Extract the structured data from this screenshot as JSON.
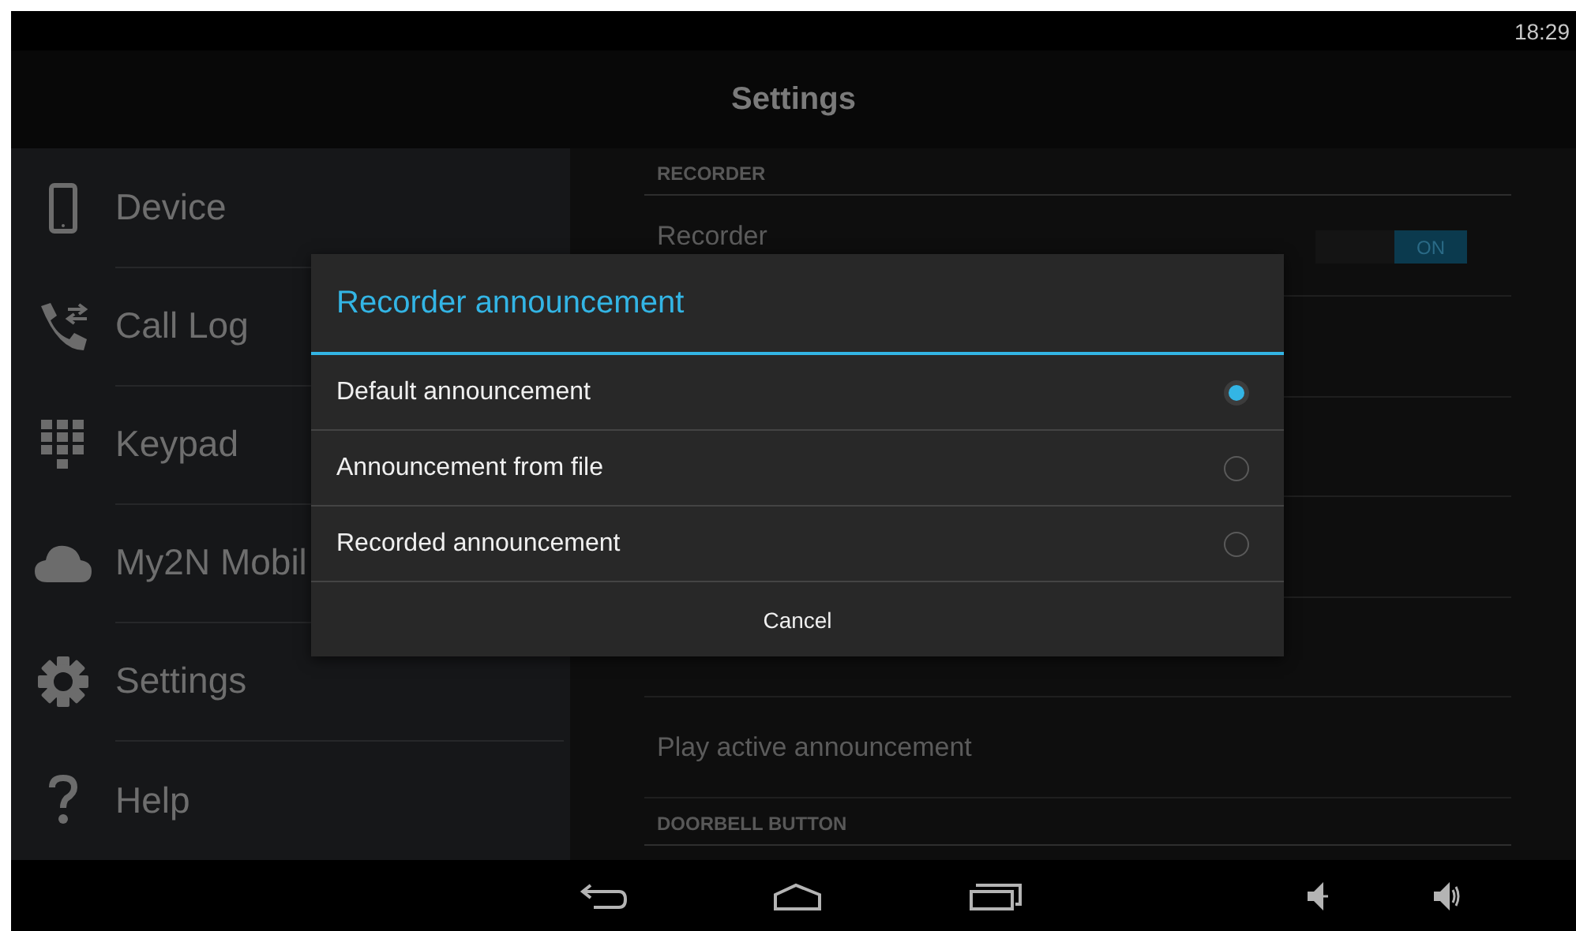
{
  "status_bar": {
    "time": "18:29"
  },
  "action_bar": {
    "title": "Settings"
  },
  "sidebar": {
    "items": [
      {
        "kind": "phone",
        "label": "Device"
      },
      {
        "kind": "call-log",
        "label": "Call Log"
      },
      {
        "kind": "keypad",
        "label": "Keypad"
      },
      {
        "kind": "cloud",
        "label": "My2N Mobil"
      },
      {
        "kind": "gear",
        "label": "Settings"
      },
      {
        "kind": "help",
        "label": "Help"
      }
    ]
  },
  "settings_list": {
    "items": [
      {
        "kind": "header",
        "label": "RECORDER"
      },
      {
        "kind": "toggle",
        "label": "Recorder",
        "on": true,
        "toggle_text": "ON"
      },
      {
        "kind": "covered"
      },
      {
        "kind": "plain",
        "label": "Play active announcement"
      },
      {
        "kind": "header",
        "label": "DOORBELL BUTTON"
      }
    ]
  },
  "dialog": {
    "title": "Recorder announcement",
    "options": [
      {
        "label": "Default announcement",
        "selected": true
      },
      {
        "label": "Announcement from file",
        "selected": false
      },
      {
        "label": "Recorded announcement",
        "selected": false
      }
    ],
    "cancel": "Cancel"
  }
}
